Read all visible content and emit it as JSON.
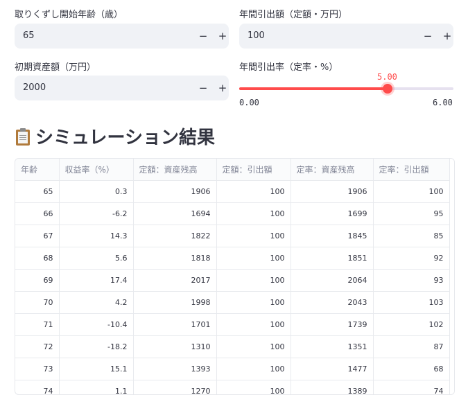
{
  "inputs": {
    "start_age": {
      "label": "取りくずし開始年齢（歳）",
      "value": "65"
    },
    "annual_fixed": {
      "label": "年間引出額（定額・万円）",
      "value": "100"
    },
    "initial_assets": {
      "label": "初期資産額（万円）",
      "value": "2000"
    },
    "minus_symbol": "−",
    "plus_symbol": "+"
  },
  "slider": {
    "label": "年間引出率（定率・%）",
    "value": "5.00",
    "min": "0.00",
    "max": "6.00",
    "fraction": 0.8333
  },
  "results": {
    "icon": "clipboard-icon",
    "title": "シミュレーション結果",
    "columns": [
      "年齢",
      "収益率（%）",
      "定額：資産残高",
      "定額：引出額",
      "定率：資産残高",
      "定率：引出額"
    ],
    "rows": [
      [
        "65",
        "0.3",
        "1906",
        "100",
        "1906",
        "100"
      ],
      [
        "66",
        "-6.2",
        "1694",
        "100",
        "1699",
        "95"
      ],
      [
        "67",
        "14.3",
        "1822",
        "100",
        "1845",
        "85"
      ],
      [
        "68",
        "5.6",
        "1818",
        "100",
        "1851",
        "92"
      ],
      [
        "69",
        "17.4",
        "2017",
        "100",
        "2064",
        "93"
      ],
      [
        "70",
        "4.2",
        "1998",
        "100",
        "2043",
        "103"
      ],
      [
        "71",
        "-10.4",
        "1701",
        "100",
        "1739",
        "102"
      ],
      [
        "72",
        "-18.2",
        "1310",
        "100",
        "1351",
        "87"
      ],
      [
        "73",
        "15.1",
        "1393",
        "100",
        "1477",
        "68"
      ],
      [
        "74",
        "1.1",
        "1270",
        "100",
        "1389",
        "74"
      ]
    ]
  },
  "colors": {
    "accent": "#ff4b4b",
    "input_bg": "#f0f2f6",
    "text": "#31333f"
  }
}
